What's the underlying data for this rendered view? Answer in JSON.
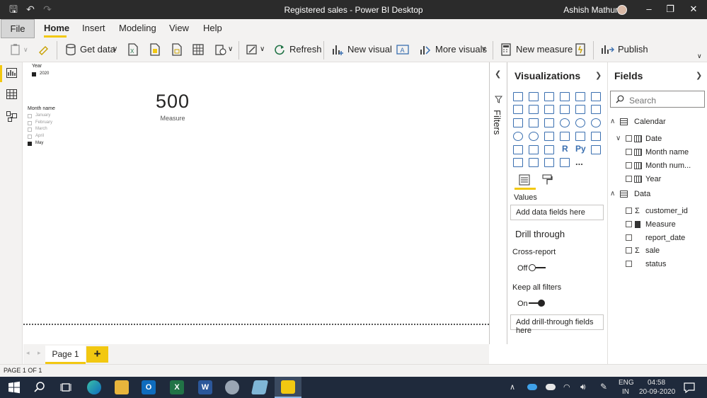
{
  "titlebar": {
    "title": "Registered sales - Power BI Desktop",
    "user": "Ashish Mathur"
  },
  "tabs": {
    "file": "File",
    "home": "Home",
    "insert": "Insert",
    "modeling": "Modeling",
    "view": "View",
    "help": "Help"
  },
  "ribbon": {
    "get_data": "Get data",
    "refresh": "Refresh",
    "new_visual": "New visual",
    "more_visuals": "More visuals",
    "new_measure": "New measure",
    "publish": "Publish"
  },
  "canvas": {
    "year_slicer": {
      "title": "Year",
      "items": [
        {
          "label": "2020",
          "checked": true
        }
      ]
    },
    "month_slicer": {
      "title": "Month name",
      "items": [
        {
          "label": "January",
          "checked": false
        },
        {
          "label": "February",
          "checked": false
        },
        {
          "label": "March",
          "checked": false
        },
        {
          "label": "April",
          "checked": false
        },
        {
          "label": "May",
          "checked": true
        }
      ]
    },
    "card": {
      "value": "500",
      "label": "Measure"
    }
  },
  "filters": {
    "label": "Filters"
  },
  "visualizations": {
    "title": "Visualizations",
    "values_label": "Values",
    "values_placeholder": "Add data fields here",
    "drill_title": "Drill through",
    "cross_report_label": "Cross-report",
    "cross_report_state": "Off",
    "keep_filters_label": "Keep all filters",
    "keep_filters_state": "On",
    "drill_placeholder": "Add drill-through fields here",
    "r_label": "R",
    "py_label": "Py",
    "more_label": "..."
  },
  "fields": {
    "title": "Fields",
    "search_placeholder": "Search",
    "tables": [
      {
        "name": "Calendar",
        "items": [
          "Date",
          "Month name",
          "Month num...",
          "Year"
        ]
      },
      {
        "name": "Data",
        "items": [
          "customer_id",
          "Measure",
          "report_date",
          "sale",
          "status"
        ]
      }
    ]
  },
  "pages": {
    "page1": "Page 1",
    "add": "+",
    "status": "PAGE 1 OF 1"
  },
  "taskbar": {
    "lang1": "ENG",
    "lang2": "IN",
    "time": "04:58",
    "date": "20-09-2020"
  },
  "colors": {
    "accent": "#f2c811",
    "titlebar": "#2b2b2b",
    "taskbar": "#1f2a3c",
    "viz_icon": "#3a6fb0"
  }
}
